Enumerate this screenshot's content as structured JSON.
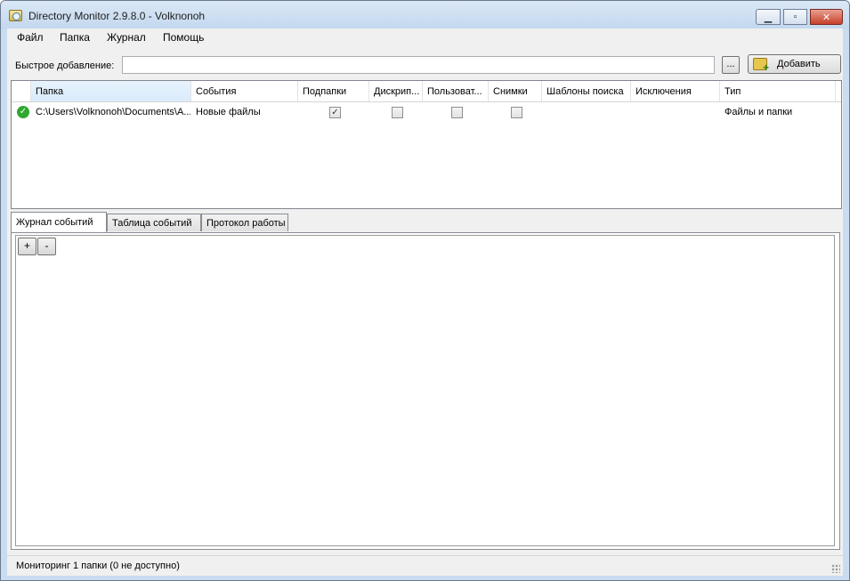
{
  "window": {
    "title": "Directory Monitor 2.9.8.0 - Volknonoh",
    "minimize_glyph": "▁",
    "maximize_glyph": "▫",
    "close_glyph": "✕"
  },
  "menu": {
    "items": [
      "Файл",
      "Папка",
      "Журнал",
      "Помощь"
    ]
  },
  "quick_add": {
    "label": "Быстрое добавление:",
    "value": "",
    "browse_label": "...",
    "add_label": "Добавить"
  },
  "table": {
    "columns": [
      "Папка",
      "События",
      "Подпапки",
      "Дискрип...",
      "Пользоват...",
      "Снимки",
      "Шаблоны поиска",
      "Исключения",
      "Тип"
    ],
    "sort_glyph": "ˆ",
    "rows": [
      {
        "status_icon": "check-circle-icon",
        "folder": "C:\\Users\\Volknonoh\\Documents\\A...",
        "events": "Новые файлы",
        "subfolders": true,
        "descriptor": false,
        "user": false,
        "snapshots": false,
        "search_patterns": "",
        "exclusions": "",
        "type": "Файлы и папки"
      }
    ]
  },
  "tabs": {
    "items": [
      "Журнал событий",
      "Таблица событий",
      "Протокол работы"
    ],
    "active": 0
  },
  "log": {
    "plus_label": "+",
    "minus_label": "-"
  },
  "status": {
    "text": "Мониторинг 1 папки (0 не доступно)"
  },
  "colors": {
    "titlebar": "#c9dcf1",
    "close_button": "#c7402b",
    "status_ok": "#2fa82f"
  }
}
